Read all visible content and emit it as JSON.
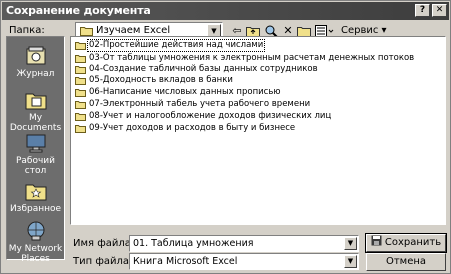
{
  "window": {
    "title": "Сохранение документа",
    "help_glyph": "?",
    "close_glyph": "✕"
  },
  "toolbar": {
    "look_in_label": "Папка:",
    "look_in_value": "Изучаем Excel",
    "tools_label": "Сервис ▾"
  },
  "places": [
    {
      "label": "Журнал",
      "icon": "history-icon"
    },
    {
      "label": "My Documents",
      "icon": "my-documents-icon"
    },
    {
      "label": "Рабочий стол",
      "icon": "desktop-icon"
    },
    {
      "label": "Избранное",
      "icon": "favorites-icon"
    },
    {
      "label": "My Network Places",
      "icon": "network-places-icon"
    }
  ],
  "files": [
    "02-Простейшие действия над числами",
    "03-От таблицы умножения к электронным расчетам денежных потоков",
    "04-Создание табличной базы данных сотрудников",
    "05-Доходность вкладов в банки",
    "06-Написание числовых данных прописью",
    "07-Электронный табель учета рабочего времени",
    "08-Учет и налогообложение доходов физических лиц",
    "09-Учет доходов и расходов в быту и бизнесе"
  ],
  "filename": {
    "label": "Имя файла:",
    "value": "01. Таблица умножения"
  },
  "filetype": {
    "label": "Тип файла:",
    "value": "Книга Microsoft Excel"
  },
  "buttons": {
    "save": "Сохранить",
    "cancel": "Отмена"
  }
}
